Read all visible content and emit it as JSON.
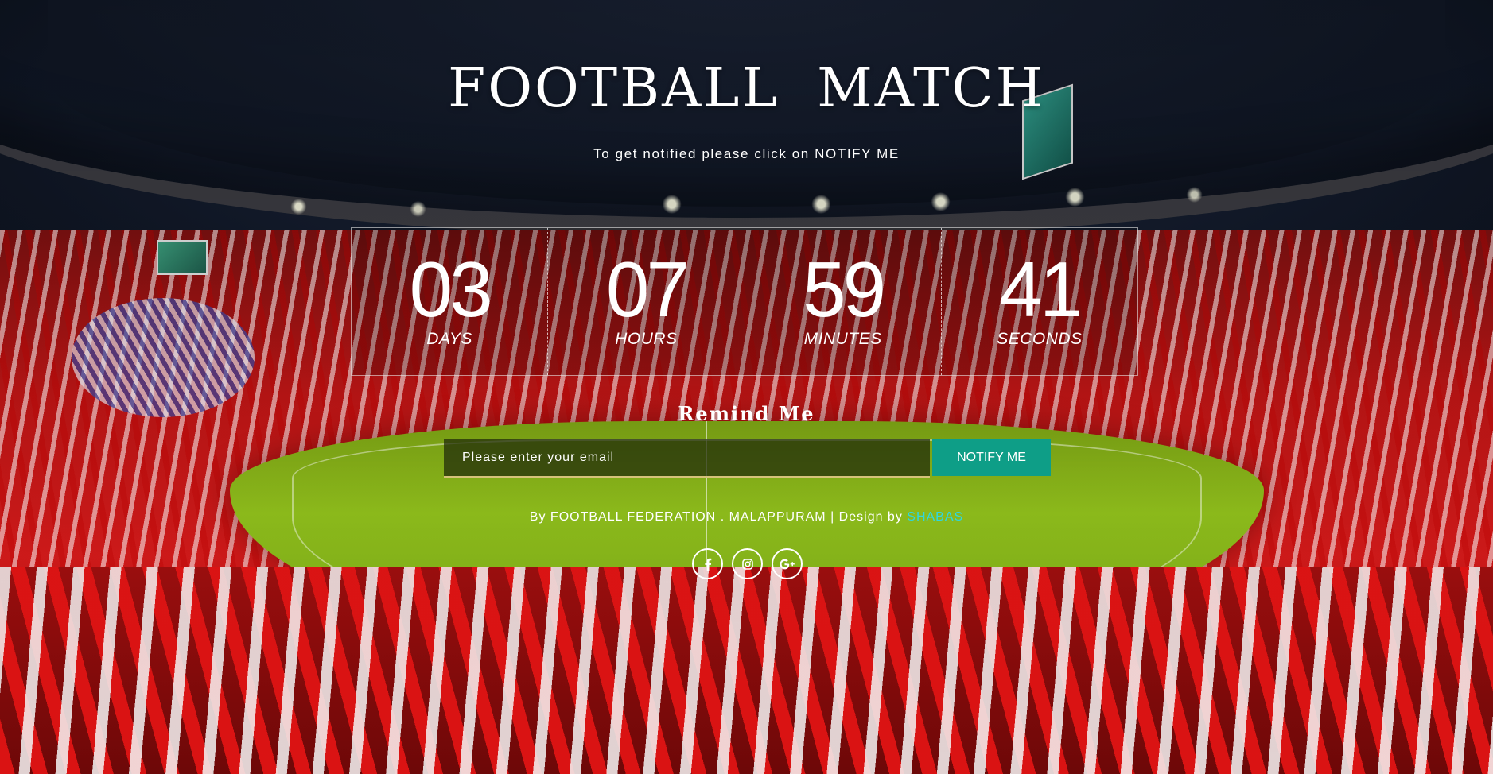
{
  "page": {
    "title": "FOOTBALL  MATCH",
    "subtitle": "To get notified please click on NOTIFY ME"
  },
  "countdown": {
    "days": {
      "value": "03",
      "label": "DAYS"
    },
    "hours": {
      "value": "07",
      "label": "HOURS"
    },
    "minutes": {
      "value": "59",
      "label": "MINUTES"
    },
    "seconds": {
      "value": "41",
      "label": "SECONDS"
    }
  },
  "remind": {
    "heading": "Remind Me",
    "email_placeholder": "Please enter your email",
    "email_value": "",
    "button_label": "NOTIFY ME"
  },
  "footer": {
    "credit_prefix": "By FOOTBALL FEDERATION . MALAPPURAM | Design by ",
    "designer": "SHABAS"
  },
  "social": [
    {
      "name": "facebook-icon"
    },
    {
      "name": "instagram-icon"
    },
    {
      "name": "google-plus-icon"
    }
  ],
  "colors": {
    "accent": "#0e9e87",
    "designer_link": "#2fd7e0",
    "input_underline": "#d6c27a"
  }
}
